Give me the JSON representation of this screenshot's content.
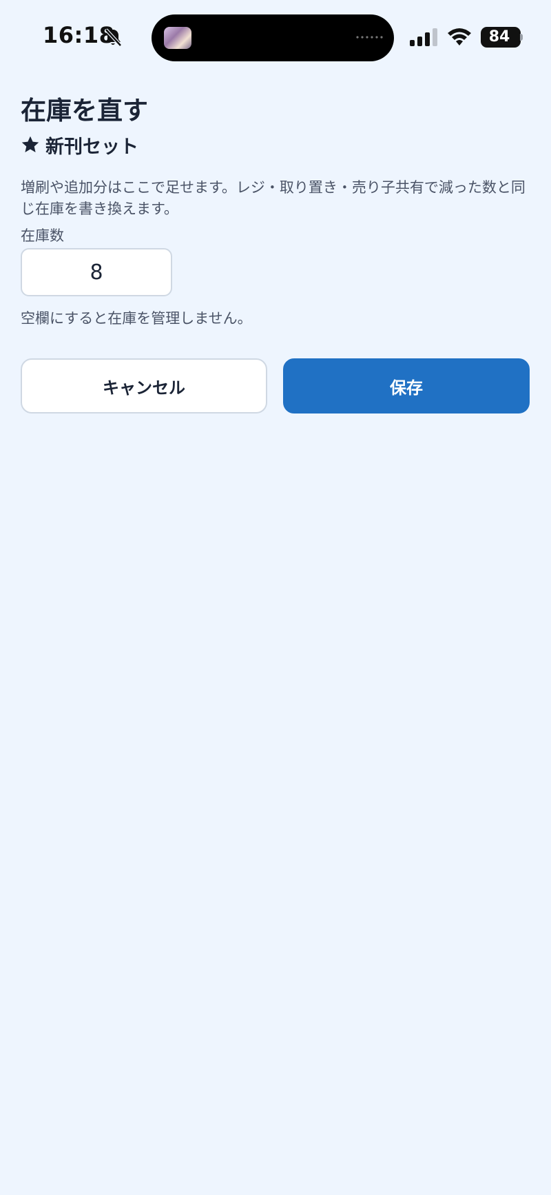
{
  "status_bar": {
    "time": "16:18",
    "battery_level": "84",
    "icons": [
      "bell-slash-icon",
      "cellular-signal-icon",
      "wifi-icon",
      "battery-icon"
    ]
  },
  "page": {
    "title": "在庫を直す",
    "item_name": "新刊セット",
    "item_icon": "star-icon",
    "description": "増刷や追加分はここで足せます。レジ・取り置き・売り子共有で減った数と同じ在庫を書き換えます。"
  },
  "form": {
    "stock_label": "在庫数",
    "stock_value": "8",
    "hint": "空欄にすると在庫を管理しません。"
  },
  "actions": {
    "cancel_label": "キャンセル",
    "save_label": "保存"
  },
  "colors": {
    "background": "#eef5fe",
    "accent": "#2071c4",
    "text": "#1b2436"
  }
}
